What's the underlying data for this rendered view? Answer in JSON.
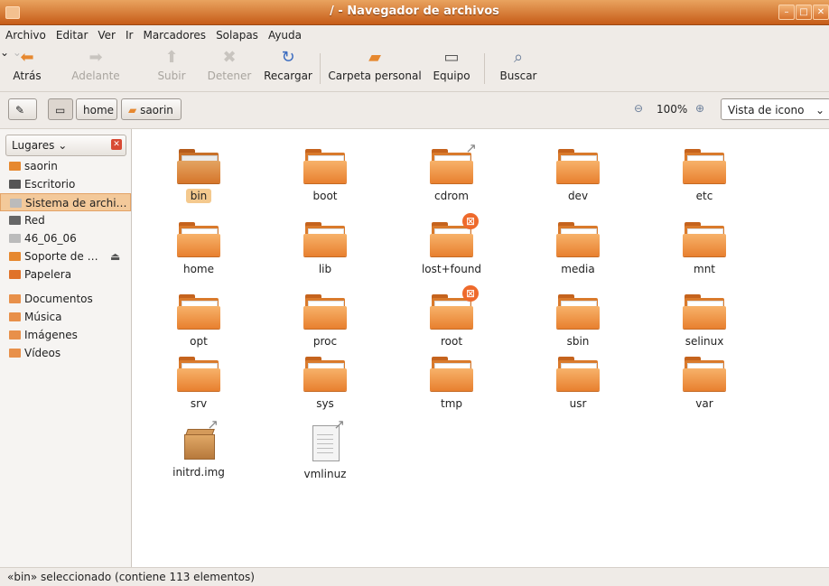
{
  "window": {
    "title": "/ - Navegador de archivos"
  },
  "menu": [
    "Archivo",
    "Editar",
    "Ver",
    "Ir",
    "Marcadores",
    "Solapas",
    "Ayuda"
  ],
  "toolbar": {
    "back": "Atrás",
    "forward": "Adelante",
    "up": "Subir",
    "stop": "Detener",
    "reload": "Recargar",
    "home": "Carpeta personal",
    "computer": "Equipo",
    "search": "Buscar"
  },
  "location": {
    "crumbs": [
      "home",
      "saorin"
    ],
    "zoom": "100%",
    "view_mode": "Vista de icono"
  },
  "sidebar": {
    "header": "Lugares",
    "items": [
      "saorin",
      "Escritorio",
      "Sistema de archi…",
      "Red",
      "46_06_06",
      "Soporte de …",
      "Papelera",
      "Documentos",
      "Música",
      "Imágenes",
      "Vídeos"
    ]
  },
  "files": [
    "bin",
    "boot",
    "cdrom",
    "dev",
    "etc",
    "home",
    "lib",
    "lost+found",
    "media",
    "mnt",
    "opt",
    "proc",
    "root",
    "sbin",
    "selinux",
    "srv",
    "sys",
    "tmp",
    "usr",
    "var",
    "initrd.img",
    "vmlinuz"
  ],
  "status": "«bin» seleccionado (contiene 113 elementos)",
  "colors": {
    "accent": "#d97a2c",
    "titlebar": "#c65c18",
    "selection": "#f4c98e"
  }
}
